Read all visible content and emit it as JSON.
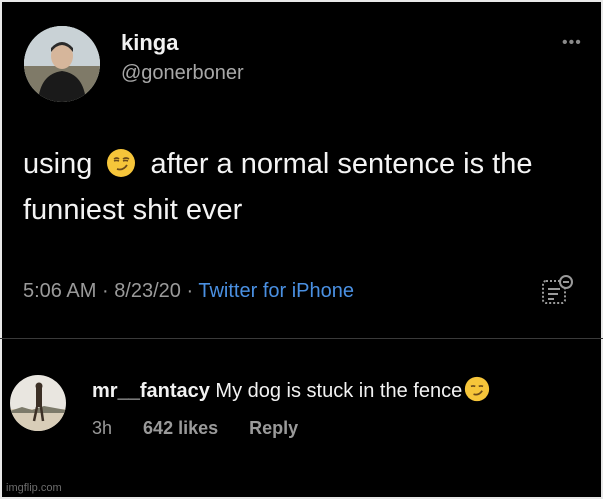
{
  "tweet": {
    "display_name": "kinga",
    "handle": "@gonerboner",
    "more_icon": "more-options-icon",
    "text_part1": "using",
    "emoji": "smirking-face-emoji",
    "text_part2": "after a normal sentence is the funniest shit ever",
    "time": "5:06 AM",
    "date": "8/23/20",
    "source": "Twitter for iPhone",
    "sep": "·"
  },
  "comment": {
    "username": "mr__fantacy",
    "text": "My dog is stuck in the fence",
    "emoji": "smirking-face-emoji",
    "age": "3h",
    "likes": "642 likes",
    "reply_label": "Reply"
  },
  "watermark": "imgflip.com",
  "colors": {
    "background": "#000000",
    "source_link": "#4a90e2",
    "muted_text": "#9a9a9a"
  }
}
